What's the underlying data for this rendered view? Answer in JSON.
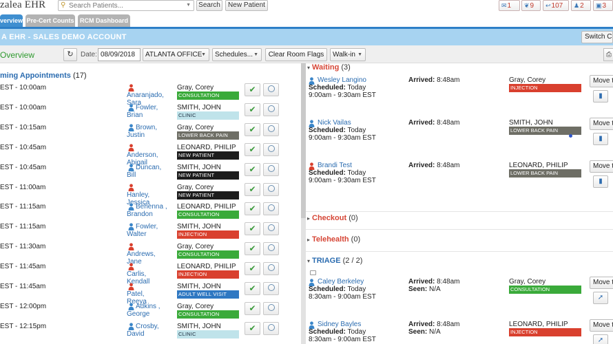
{
  "header": {
    "logo": "zalea EHR",
    "search_placeholder": "Search Patients...",
    "search_button": "Search",
    "new_patient_button": "New Patient",
    "badges": [
      {
        "icon": "inbox-icon",
        "count": "1"
      },
      {
        "icon": "wrench-icon",
        "count": "9"
      },
      {
        "icon": "reply-icon",
        "count": "107"
      },
      {
        "icon": "person-icon",
        "count": "2"
      },
      {
        "icon": "monitor-icon",
        "count": "3"
      }
    ]
  },
  "tabs": [
    {
      "label": "verview",
      "active": true
    },
    {
      "label": "Pre-Cert Counts",
      "active": false
    },
    {
      "label": "RCM Dashboard",
      "active": false
    }
  ],
  "banner": {
    "title": "A EHR - SALES DEMO ACCOUNT",
    "switch_label": "Switch C"
  },
  "toolbar": {
    "title": "Overview",
    "date_label": "Date:",
    "date_value": "08/09/2018",
    "office": "ATLANTA OFFICE",
    "schedules": "Schedules...",
    "clear_rooms": "Clear Room Flags",
    "walkin": "Walk-in"
  },
  "colors": {
    "consultation": "#3aaa3a",
    "clinic": "#bfe3ea",
    "lower_back_pain": "#6e6e65",
    "new_patient": "#1c1c1c",
    "injection": "#d9402e",
    "adult_well_visit": "#2f78c2",
    "female_icon": "#d9402e",
    "male_icon": "#3b86c9"
  },
  "upcoming": {
    "title": "ming Appointments",
    "count": "(17)",
    "rows": [
      {
        "time": "EST - 10:00am",
        "last": "Anaranjado,",
        "first": "Sara",
        "gender": "f",
        "provider": "Gray, Corey",
        "tag": "CONSULTATION",
        "tag_type": "consultation"
      },
      {
        "time": "EST - 10:00am",
        "last": "Fowler,",
        "first": "Brian",
        "gender": "m",
        "provider": "SMITH, JOHN",
        "tag": "CLINIC",
        "tag_type": "clinic"
      },
      {
        "time": "EST - 10:15am",
        "last": "Brown,",
        "first": "Justin",
        "gender": "m",
        "provider": "Gray, Corey",
        "tag": "LOWER BACK PAIN",
        "tag_type": "lower_back_pain"
      },
      {
        "time": "EST - 10:45am",
        "last": "Anderson,",
        "first": "Abigail",
        "gender": "f",
        "provider": "LEONARD, PHILIP",
        "tag": "NEW PATIENT",
        "tag_type": "new_patient"
      },
      {
        "time": "EST - 10:45am",
        "last": "Duncan,",
        "first": "Bill",
        "gender": "m",
        "provider": "SMITH, JOHN",
        "tag": "NEW PATIENT",
        "tag_type": "new_patient"
      },
      {
        "time": "EST - 11:00am",
        "last": "Hanley,",
        "first": "Jessica",
        "gender": "f",
        "provider": "Gray, Corey",
        "tag": "NEW PATIENT",
        "tag_type": "new_patient"
      },
      {
        "time": "EST - 11:15am",
        "last": "Behenna ,",
        "first": "Brandon",
        "gender": "m",
        "provider": "LEONARD, PHILIP",
        "tag": "CONSULTATION",
        "tag_type": "consultation"
      },
      {
        "time": "EST - 11:15am",
        "last": "Fowler,",
        "first": "Walter",
        "gender": "m",
        "provider": "SMITH, JOHN",
        "tag": "INJECTION",
        "tag_type": "injection"
      },
      {
        "time": "EST - 11:30am",
        "last": "Andrews,",
        "first": "Jane",
        "gender": "f",
        "provider": "Gray, Corey",
        "tag": "CONSULTATION",
        "tag_type": "consultation"
      },
      {
        "time": "EST - 11:45am",
        "last": "Carlis,",
        "first": "Kendall",
        "gender": "f",
        "provider": "LEONARD, PHILIP",
        "tag": "INJECTION",
        "tag_type": "injection"
      },
      {
        "time": "EST - 11:45am",
        "last": "Patel,",
        "first": "Reeya",
        "gender": "f",
        "provider": "SMITH, JOHN",
        "tag": "ADULT WELL VISIT",
        "tag_type": "adult_well_visit"
      },
      {
        "time": "EST - 12:00pm",
        "last": "Adkins ,",
        "first": "George",
        "gender": "m",
        "provider": "Gray, Corey",
        "tag": "CONSULTATION",
        "tag_type": "consultation"
      },
      {
        "time": "EST - 12:15pm",
        "last": "Crosby,",
        "first": "David",
        "gender": "m",
        "provider": "SMITH, JOHN",
        "tag": "CLINIC",
        "tag_type": "clinic"
      }
    ]
  },
  "waiting": {
    "title": "Waiting",
    "count": "(3)",
    "entries": [
      {
        "name": "Wesley Langino",
        "gender": "m",
        "scheduled_label": "Scheduled:",
        "scheduled": "Today",
        "time": "9:00am - 9:30am EST",
        "arrived_label": "Arrived:",
        "arrived": "8:48am",
        "provider": "Gray, Corey",
        "tag": "INJECTION",
        "tag_type": "injection",
        "move": "Move t"
      },
      {
        "name": "Nick Vailas",
        "gender": "m",
        "scheduled_label": "Scheduled:",
        "scheduled": "Today",
        "time": "9:00am - 9:30am EST",
        "arrived_label": "Arrived:",
        "arrived": "8:48am",
        "provider": "SMITH, JOHN",
        "tag": "LOWER BACK PAIN",
        "tag_type": "lower_back_pain",
        "move": "Move t"
      },
      {
        "name": "Brandi Test",
        "gender": "f",
        "scheduled_label": "Scheduled:",
        "scheduled": "Today",
        "time": "9:00am - 9:30am EST",
        "arrived_label": "Arrived:",
        "arrived": "8:48am",
        "provider": "LEONARD, PHILIP",
        "tag": "LOWER BACK PAIN",
        "tag_type": "lower_back_pain",
        "move": "Move t"
      }
    ]
  },
  "checkout": {
    "title": "Checkout",
    "count": "(0)"
  },
  "telehealth": {
    "title": "Telehealth",
    "count": "(0)"
  },
  "triage": {
    "title": "TRIAGE",
    "count": "(2 / 2)",
    "entries": [
      {
        "name": "Caley Berkeley",
        "gender": "m",
        "scheduled_label": "Scheduled:",
        "scheduled": "Today",
        "time": "8:30am - 9:00am EST",
        "arrived_label": "Arrived:",
        "arrived": "8:48am",
        "seen_label": "Seen:",
        "seen": "N/A",
        "provider": "Gray, Corey",
        "tag": "CONSULTATION",
        "tag_type": "consultation",
        "move": "Move t"
      },
      {
        "name": "Sidney Bayles",
        "gender": "m",
        "scheduled_label": "Scheduled:",
        "scheduled": "Today",
        "time": "8:30am - 9:00am EST",
        "arrived_label": "Arrived:",
        "arrived": "8:48am",
        "seen_label": "Seen:",
        "seen": "N/A",
        "provider": "LEONARD, PHILIP",
        "tag": "INJECTION",
        "tag_type": "injection",
        "move": "Move t"
      }
    ]
  }
}
